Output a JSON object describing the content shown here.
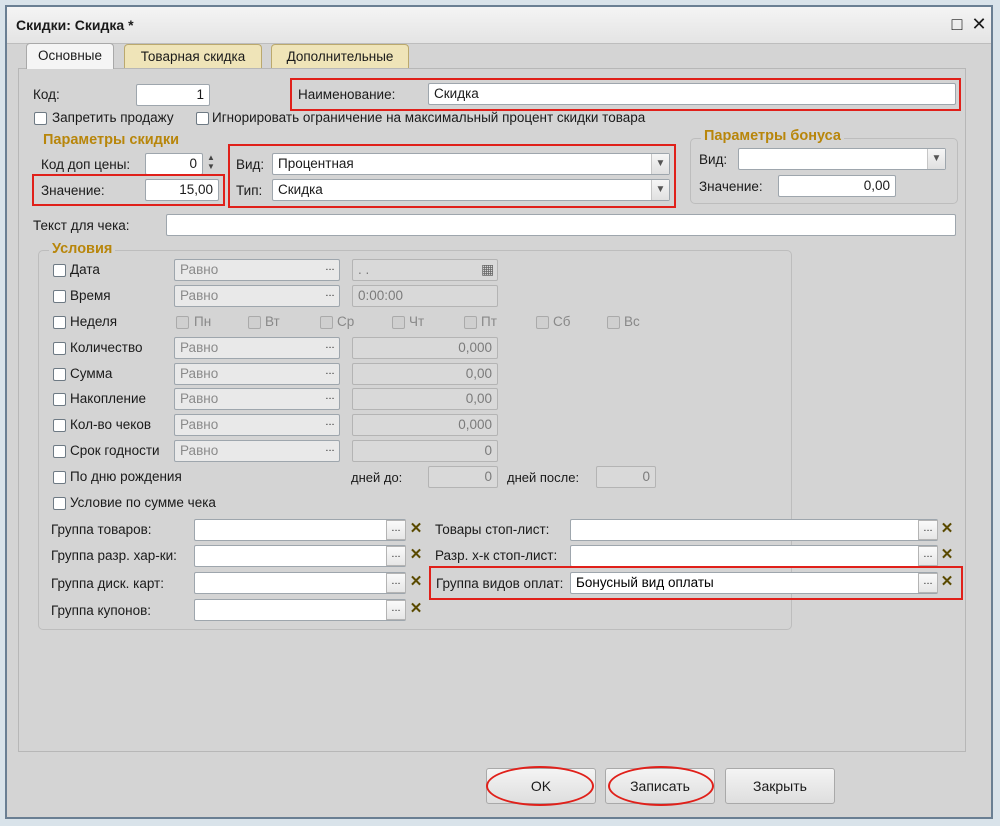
{
  "window": {
    "title": "Скидки: Скидка *",
    "maximize_icon": "□",
    "close_icon": "✕"
  },
  "tabs": [
    {
      "label": "Основные"
    },
    {
      "label": "Товарная скидка"
    },
    {
      "label": "Дополнительные"
    }
  ],
  "main": {
    "kod_label": "Код:",
    "kod_value": "1",
    "name_label": "Наименование:",
    "name_value": "Скидка",
    "forbid_sale_label": "Запретить продажу",
    "ignore_limit_label": "Игнорировать ограничение на максимальный процент скидки товара"
  },
  "discount_params": {
    "title": "Параметры скидки",
    "price_code_label": "Код доп цены:",
    "price_code_value": "0",
    "value_label": "Значение:",
    "value_value": "15,00",
    "kind_label": "Вид:",
    "kind_value": "Процентная",
    "type_label": "Тип:",
    "type_value": "Скидка"
  },
  "bonus_params": {
    "title": "Параметры бонуса",
    "kind_label": "Вид:",
    "kind_value": "",
    "value_label": "Значение:",
    "value_value": "0,00"
  },
  "receipt_text": {
    "label": "Текст для чека:",
    "value": ""
  },
  "conditions": {
    "title": "Условия",
    "rows": [
      {
        "label": "Дата",
        "op": "Равно",
        "value": " .  ."
      },
      {
        "label": "Время",
        "op": "Равно",
        "value": "0:00:00"
      },
      {
        "label": "Неделя"
      },
      {
        "label": "Количество",
        "op": "Равно",
        "value": "0,000"
      },
      {
        "label": "Сумма",
        "op": "Равно",
        "value": "0,00"
      },
      {
        "label": "Накопление",
        "op": "Равно",
        "value": "0,00"
      },
      {
        "label": "Кол-во чеков",
        "op": "Равно",
        "value": "0,000"
      },
      {
        "label": "Срок годности",
        "op": "Равно",
        "value": "0"
      }
    ],
    "weekdays": [
      "Пн",
      "Вт",
      "Ср",
      "Чт",
      "Пт",
      "Сб",
      "Вс"
    ],
    "birthday_label": "По дню рождения",
    "days_before_label": "дней до:",
    "days_before_value": "0",
    "days_after_label": "дней после:",
    "days_after_value": "0",
    "receipt_sum_label": "Условие по сумме чека",
    "groups_left": [
      {
        "label": "Группа товаров:",
        "value": ""
      },
      {
        "label": "Группа разр. хар-ки:",
        "value": ""
      },
      {
        "label": "Группа диск. карт:",
        "value": ""
      },
      {
        "label": "Группа купонов:",
        "value": ""
      }
    ],
    "groups_right": [
      {
        "label": "Товары стоп-лист:",
        "value": ""
      },
      {
        "label": "Разр. х-к стоп-лист:",
        "value": ""
      },
      {
        "label": "Группа видов оплат:",
        "value": "Бонусный вид оплаты"
      }
    ]
  },
  "buttons": {
    "ok": "OK",
    "save": "Записать",
    "close": "Закрыть"
  },
  "glyphs": {
    "dots": "...",
    "clear": "✕",
    "dropdown": "▼",
    "spin_up": "▲",
    "spin_down": "▼",
    "calendar": "▦"
  }
}
